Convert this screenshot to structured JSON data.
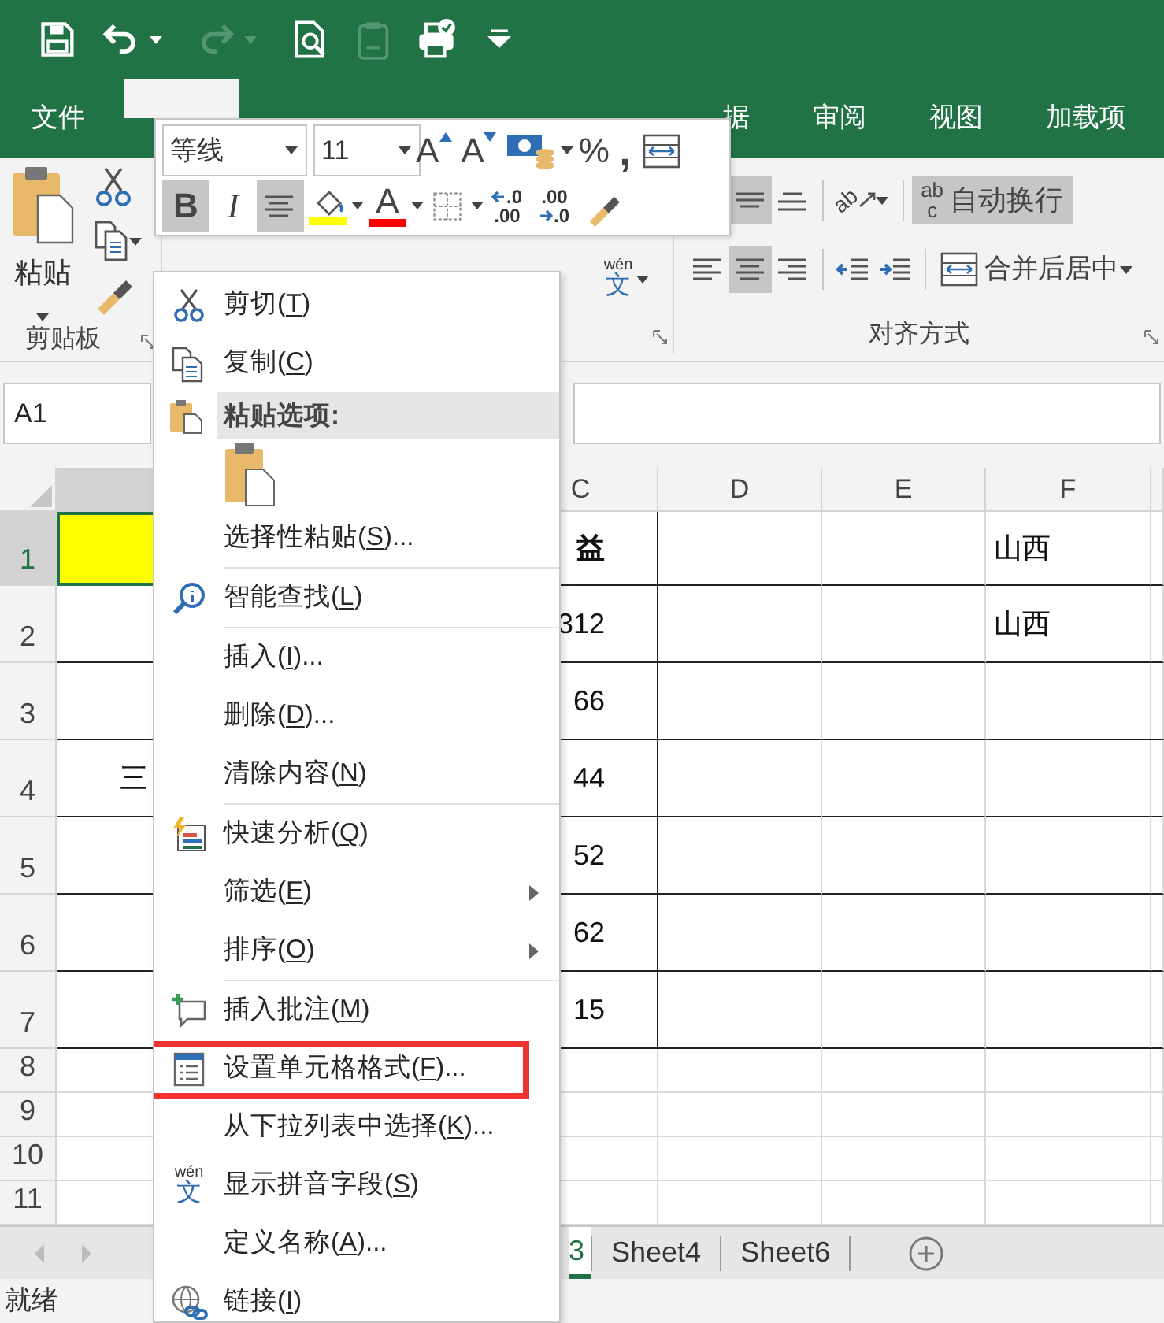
{
  "quick_access": [
    {
      "kind": "save",
      "disabled": false
    },
    {
      "kind": "undo",
      "disabled": false
    },
    {
      "kind": "dropdown",
      "disabled": false
    },
    {
      "kind": "redo",
      "disabled": true
    },
    {
      "kind": "dropdown",
      "disabled": true
    },
    {
      "kind": "print_preview",
      "disabled": false
    },
    {
      "kind": "paste_values",
      "disabled": true
    },
    {
      "kind": "print",
      "disabled": false
    },
    {
      "kind": "customize",
      "disabled": false
    }
  ],
  "tabs": [
    {
      "label": "文件",
      "selected": false
    },
    {
      "selected": true
    },
    {
      "label": "据",
      "selected": false
    },
    {
      "label": "审阅",
      "selected": false
    },
    {
      "label": "视图",
      "selected": false
    },
    {
      "label": "加载项",
      "selected": false
    }
  ],
  "ribbon": {
    "clipboard": {
      "paste_label": "粘贴",
      "group_label": "剪贴板"
    },
    "font": {
      "tools": [
        {
          "kind": "phonetic",
          "top": "wén",
          "bottom": "文"
        }
      ]
    },
    "alignment": {
      "group_label": "对齐方式",
      "top_row": [
        {
          "kind": "align_middle",
          "pressed": true
        },
        {
          "kind": "align_bottom",
          "pressed": false
        },
        {
          "kind": "orientation",
          "text": "ab",
          "pressed": false
        },
        {
          "kind": "wrap_text",
          "icon_top": "ab",
          "icon_bottom": "c",
          "label": "自动换行",
          "pressed": true
        }
      ],
      "bottom_row": [
        {
          "kind": "align_left",
          "pressed": false
        },
        {
          "kind": "align_center",
          "pressed": true
        },
        {
          "kind": "align_right",
          "pressed": false
        },
        {
          "kind": "indent_decrease",
          "pressed": false
        },
        {
          "kind": "indent_increase",
          "pressed": false
        },
        {
          "kind": "merge_center",
          "label": "合并后居中",
          "pressed": false
        }
      ]
    }
  },
  "formula_bar": {
    "name_box": "A1"
  },
  "sheet": {
    "column_headers": [
      {
        "label": "C"
      },
      {
        "label": "D"
      },
      {
        "label": "E"
      },
      {
        "label": "F"
      }
    ],
    "rows": [
      {
        "header": "1",
        "selected": true,
        "a_highlighted": true,
        "c": "益",
        "c_bold": true,
        "f": "山西"
      },
      {
        "header": "2",
        "selected": false,
        "a_highlighted": false,
        "c": "312",
        "c_bold": false,
        "f": "山西"
      },
      {
        "header": "3",
        "selected": false,
        "a_highlighted": false,
        "c": "66",
        "c_bold": false
      },
      {
        "header": "4",
        "selected": false,
        "a_highlighted": false,
        "a": "三",
        "c": "44",
        "c_bold": false
      },
      {
        "header": "5",
        "selected": false,
        "a_highlighted": false,
        "c": "52",
        "c_bold": false
      },
      {
        "header": "6",
        "selected": false,
        "a_highlighted": false,
        "c": "62",
        "c_bold": false
      },
      {
        "header": "7",
        "selected": false,
        "a_highlighted": false,
        "c": "15",
        "c_bold": false
      },
      {
        "header": "8",
        "selected": false,
        "a_highlighted": false
      },
      {
        "header": "9",
        "selected": false,
        "a_highlighted": false
      },
      {
        "header": "10",
        "selected": false,
        "a_highlighted": false
      },
      {
        "header": "11",
        "selected": false,
        "a_highlighted": false
      }
    ]
  },
  "sheet_tabs": [
    {
      "label": "3",
      "selected": true
    },
    {
      "label": "Sheet4",
      "selected": false
    },
    {
      "label": "Sheet6",
      "selected": false
    }
  ],
  "status_bar": {
    "text": "就绪"
  },
  "mini_toolbar": {
    "font": "等线",
    "size": "11",
    "row1": [
      {
        "kind": "grow_font",
        "text": "A"
      },
      {
        "kind": "shrink_font",
        "text": "A"
      },
      {
        "kind": "accounting"
      },
      {
        "kind": "percent",
        "text": "%"
      },
      {
        "kind": "comma",
        "text": ","
      },
      {
        "kind": "wrap_merge"
      }
    ],
    "row2": [
      {
        "kind": "bold",
        "text": "B",
        "pressed": true
      },
      {
        "kind": "italic",
        "text": "I",
        "pressed": false
      },
      {
        "kind": "center",
        "pressed": true
      },
      {
        "kind": "fill_color",
        "color": "#ffff00",
        "pressed": false
      },
      {
        "kind": "font_color",
        "text": "A",
        "color": "#ff0000",
        "pressed": false
      },
      {
        "kind": "borders",
        "pressed": false
      },
      {
        "kind": "increase_decimal",
        "top": ".0",
        "bottom": ".00",
        "pressed": false
      },
      {
        "kind": "decrease_decimal",
        "top": ".00",
        "bottom": ".0",
        "pressed": false
      },
      {
        "kind": "format_painter",
        "pressed": false
      }
    ]
  },
  "context_menu": [
    {
      "kind": "cut",
      "label": "剪切(",
      "mnemonic": "T",
      "tail": ")"
    },
    {
      "kind": "copy",
      "label": "复制(",
      "mnemonic": "C",
      "tail": ")"
    },
    {
      "kind": "heading",
      "label": "粘贴选项:"
    },
    {
      "kind": "paste_option"
    },
    {
      "kind": "command",
      "label": "选择性粘贴(",
      "mnemonic": "S",
      "tail": ")..."
    },
    {
      "kind": "separator"
    },
    {
      "kind": "smart_lookup",
      "label": "智能查找(",
      "mnemonic": "L",
      "tail": ")"
    },
    {
      "kind": "separator"
    },
    {
      "kind": "command",
      "label": "插入(",
      "mnemonic": "I",
      "tail": ")..."
    },
    {
      "kind": "command",
      "label": "删除(",
      "mnemonic": "D",
      "tail": ")..."
    },
    {
      "kind": "command",
      "label": "清除内容(",
      "mnemonic": "N",
      "tail": ")"
    },
    {
      "kind": "separator"
    },
    {
      "kind": "quick_analysis",
      "label": "快速分析(",
      "mnemonic": "Q",
      "tail": ")"
    },
    {
      "kind": "command",
      "label": "筛选(",
      "mnemonic": "E",
      "tail": ")",
      "submenu": true
    },
    {
      "kind": "command",
      "label": "排序(",
      "mnemonic": "O",
      "tail": ")",
      "submenu": true
    },
    {
      "kind": "separator"
    },
    {
      "kind": "comment",
      "label": "插入批注(",
      "mnemonic": "M",
      "tail": ")"
    },
    {
      "kind": "format_cells",
      "label": "设置单元格格式(",
      "mnemonic": "F",
      "tail": ")...",
      "outlined": true
    },
    {
      "kind": "command",
      "label": "从下拉列表中选择(",
      "mnemonic": "K",
      "tail": ")..."
    },
    {
      "kind": "phonetic",
      "icon_top": "wén",
      "icon_bottom": "文",
      "label": "显示拼音字段(",
      "mnemonic": "S",
      "tail": ")"
    },
    {
      "kind": "command",
      "label": "定义名称(",
      "mnemonic": "A",
      "tail": ")..."
    },
    {
      "kind": "link",
      "label": "链接(",
      "mnemonic": "I",
      "tail": ")"
    }
  ]
}
